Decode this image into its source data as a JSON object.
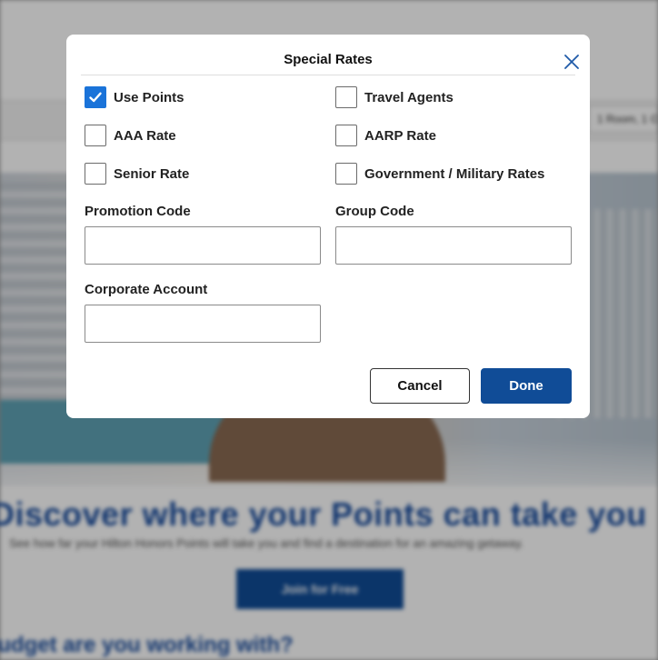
{
  "background": {
    "rooms_selector": "1 Room, 1 G",
    "headline": "Discover where your Points can take you",
    "subline": "See how far your Hilton Honors Points will take you and find a destination for an amazing getaway.",
    "join_button": "Join for Free",
    "bottom_text": "Budget are you working with?"
  },
  "modal": {
    "title": "Special Rates",
    "checkboxes": [
      {
        "label": "Use Points",
        "checked": true
      },
      {
        "label": "Travel Agents",
        "checked": false
      },
      {
        "label": "AAA Rate",
        "checked": false
      },
      {
        "label": "AARP Rate",
        "checked": false
      },
      {
        "label": "Senior Rate",
        "checked": false
      },
      {
        "label": "Government / Military Rates",
        "checked": false
      }
    ],
    "fields": {
      "promotion_code": {
        "label": "Promotion Code",
        "value": ""
      },
      "group_code": {
        "label": "Group Code",
        "value": ""
      },
      "corporate_account": {
        "label": "Corporate Account",
        "value": ""
      }
    },
    "buttons": {
      "cancel": "Cancel",
      "done": "Done"
    }
  },
  "colors": {
    "primary": "#104c97",
    "checkbox_checked": "#1a73d9"
  }
}
